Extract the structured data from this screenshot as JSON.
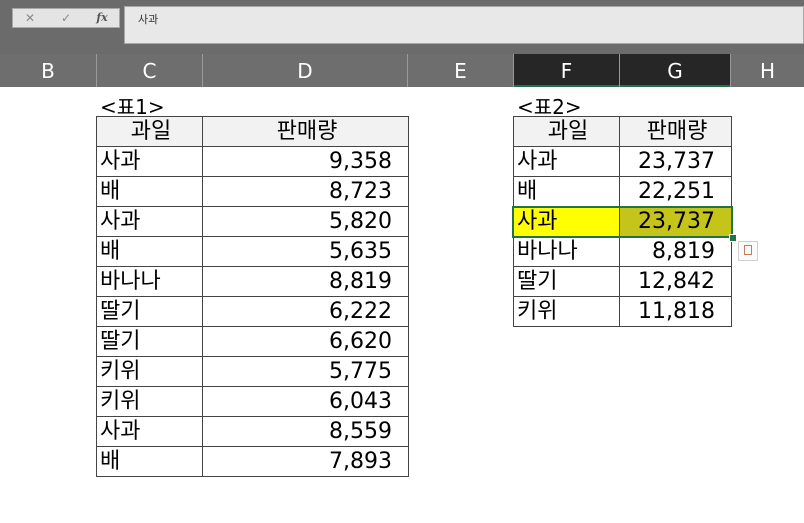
{
  "formula_bar": {
    "cancel_icon": "✕",
    "enter_icon": "✓",
    "fx_label": "fx",
    "content": "사과"
  },
  "columns": [
    "B",
    "C",
    "D",
    "E",
    "F",
    "G",
    "H"
  ],
  "selected_columns": [
    "F",
    "G"
  ],
  "table1": {
    "title": "<표1>",
    "headers": [
      "과일",
      "판매량"
    ],
    "rows": [
      [
        "사과",
        "9,358"
      ],
      [
        "배",
        "8,723"
      ],
      [
        "사과",
        "5,820"
      ],
      [
        "배",
        "5,635"
      ],
      [
        "바나나",
        "8,819"
      ],
      [
        "딸기",
        "6,222"
      ],
      [
        "딸기",
        "6,620"
      ],
      [
        "키위",
        "5,775"
      ],
      [
        "키위",
        "6,043"
      ],
      [
        "사과",
        "8,559"
      ],
      [
        "배",
        "7,893"
      ]
    ]
  },
  "table2": {
    "title": "<표2>",
    "headers": [
      "과일",
      "판매량"
    ],
    "rows": [
      [
        "사과",
        "23,737"
      ],
      [
        "배",
        "22,251"
      ],
      [
        "사과",
        "23,737"
      ],
      [
        "바나나",
        "8,819"
      ],
      [
        "딸기",
        "12,842"
      ],
      [
        "키위",
        "11,818"
      ]
    ],
    "highlighted_row": 2,
    "highlight_colors": [
      "#ffff00",
      "#c4c41a"
    ]
  },
  "quick_analysis_icon": "paste-options-icon"
}
